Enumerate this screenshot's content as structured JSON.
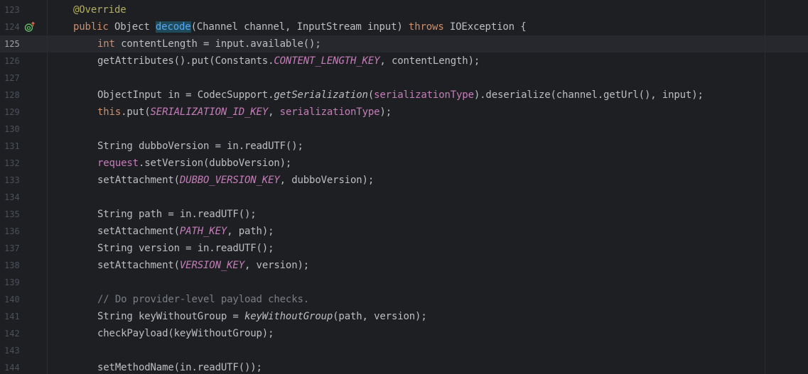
{
  "editor": {
    "active_line": "125",
    "gutter_icon": "override-up-arrow-icon",
    "lines": [
      {
        "num": "123",
        "code": "@Override"
      },
      {
        "num": "124",
        "code": "public Object decode(Channel channel, InputStream input) throws IOException {"
      },
      {
        "num": "125",
        "code": "int contentLength = input.available();"
      },
      {
        "num": "126",
        "code": "getAttributes().put(Constants.CONTENT_LENGTH_KEY, contentLength);"
      },
      {
        "num": "127",
        "code": ""
      },
      {
        "num": "128",
        "code": "ObjectInput in = CodecSupport.getSerialization(serializationType).deserialize(channel.getUrl(), input);"
      },
      {
        "num": "129",
        "code": "this.put(SERIALIZATION_ID_KEY, serializationType);"
      },
      {
        "num": "130",
        "code": ""
      },
      {
        "num": "131",
        "code": "String dubboVersion = in.readUTF();"
      },
      {
        "num": "132",
        "code": "request.setVersion(dubboVersion);"
      },
      {
        "num": "133",
        "code": "setAttachment(DUBBO_VERSION_KEY, dubboVersion);"
      },
      {
        "num": "134",
        "code": ""
      },
      {
        "num": "135",
        "code": "String path = in.readUTF();"
      },
      {
        "num": "136",
        "code": "setAttachment(PATH_KEY, path);"
      },
      {
        "num": "137",
        "code": "String version = in.readUTF();"
      },
      {
        "num": "138",
        "code": "setAttachment(VERSION_KEY, version);"
      },
      {
        "num": "139",
        "code": ""
      },
      {
        "num": "140",
        "code": "// Do provider-level payload checks."
      },
      {
        "num": "141",
        "code": "String keyWithoutGroup = keyWithoutGroup(path, version);"
      },
      {
        "num": "142",
        "code": "checkPayload(keyWithoutGroup);"
      },
      {
        "num": "143",
        "code": ""
      },
      {
        "num": "144",
        "code": "setMethodName(in.readUTF());"
      }
    ]
  },
  "tokens": {
    "l123": [
      [
        "ann",
        "@Override"
      ]
    ],
    "l124": [
      [
        "kw",
        "public "
      ],
      [
        "",
        "Object "
      ],
      [
        "hl",
        "decode"
      ],
      [
        "",
        "(Channel channel, InputStream input) "
      ],
      [
        "kw",
        "throws "
      ],
      [
        "",
        "IOException {"
      ]
    ],
    "l125": [
      [
        "kw",
        "int "
      ],
      [
        "",
        "contentLength = input.available();"
      ]
    ],
    "l126": [
      [
        "",
        "getAttributes().put(Constants."
      ],
      [
        "const",
        "CONTENT_LENGTH_KEY"
      ],
      [
        "",
        ", contentLength);"
      ]
    ],
    "l128": [
      [
        "",
        "ObjectInput in = CodecSupport."
      ],
      [
        "static",
        "getSerialization"
      ],
      [
        "",
        "("
      ],
      [
        "field",
        "serializationType"
      ],
      [
        "",
        ").deserialize(channel.getUrl(), input);"
      ]
    ],
    "l129": [
      [
        "kw",
        "this"
      ],
      [
        "",
        ".put("
      ],
      [
        "const",
        "SERIALIZATION_ID_KEY"
      ],
      [
        "",
        ", "
      ],
      [
        "field",
        "serializationType"
      ],
      [
        "",
        ");"
      ]
    ],
    "l131": [
      [
        "",
        "String dubboVersion = in.readUTF();"
      ]
    ],
    "l132": [
      [
        "field",
        "request"
      ],
      [
        "",
        ".setVersion(dubboVersion);"
      ]
    ],
    "l133": [
      [
        "",
        "setAttachment("
      ],
      [
        "const",
        "DUBBO_VERSION_KEY"
      ],
      [
        "",
        ", dubboVersion);"
      ]
    ],
    "l135": [
      [
        "",
        "String path = in.readUTF();"
      ]
    ],
    "l136": [
      [
        "",
        "setAttachment("
      ],
      [
        "const",
        "PATH_KEY"
      ],
      [
        "",
        ", path);"
      ]
    ],
    "l137": [
      [
        "",
        "String version = in.readUTF();"
      ]
    ],
    "l138": [
      [
        "",
        "setAttachment("
      ],
      [
        "const",
        "VERSION_KEY"
      ],
      [
        "",
        ", version);"
      ]
    ],
    "l140": [
      [
        "cmt",
        "// Do provider-level payload checks."
      ]
    ],
    "l141": [
      [
        "",
        "String keyWithoutGroup = "
      ],
      [
        "static",
        "keyWithoutGroup"
      ],
      [
        "",
        "(path, version);"
      ]
    ],
    "l142": [
      [
        "",
        "checkPayload(keyWithoutGroup);"
      ]
    ],
    "l144": [
      [
        "",
        "setMethodName(in.readUTF());"
      ]
    ]
  },
  "colors": {
    "background": "#1e1f22",
    "keyword": "#cf8e6d",
    "annotation": "#b3ae60",
    "method_decl": "#56a8f5",
    "constant": "#c77dbb",
    "comment": "#7a7e85",
    "text": "#bcbec4"
  }
}
